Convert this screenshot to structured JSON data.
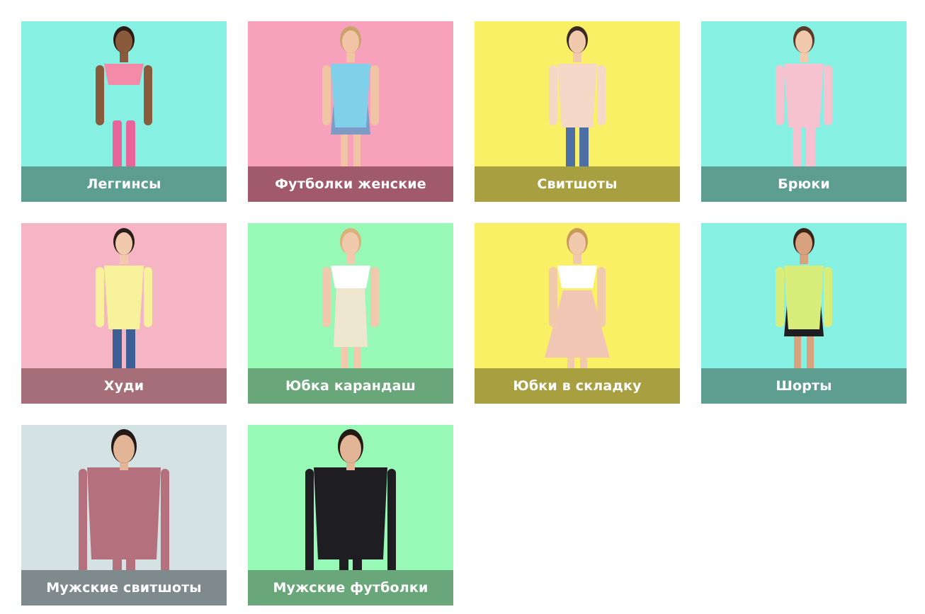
{
  "categories": [
    {
      "label": "Леггинсы",
      "bg": "#86F0E2",
      "band": "#5E9E90",
      "figure": "woman-leggings",
      "skin": "#8a5a3c",
      "hair": "#2b1d16",
      "top": "#f28aa8",
      "bottom": "#e8659b",
      "legs": "#e8659b"
    },
    {
      "label": "Футболки женские",
      "bg": "#F7A1BC",
      "band": "#A05A6B",
      "figure": "woman-tshirt",
      "skin": "#f1c4a6",
      "hair": "#c9a36a",
      "top": "#7fd0e8",
      "bottom": "#7d9bc4",
      "legs": "#f1c4a6"
    },
    {
      "label": "Свитшоты",
      "bg": "#FAF066",
      "band": "#A8A040",
      "figure": "woman-sweatshirt",
      "skin": "#f1c9ad",
      "hair": "#3a2a22",
      "top": "#f6d8c8",
      "bottom": "#4d6fa3",
      "legs": "#4d6fa3"
    },
    {
      "label": "Брюки",
      "bg": "#86F0E2",
      "band": "#5E9E90",
      "figure": "woman-pants",
      "skin": "#f1c9ad",
      "hair": "#5a3b2a",
      "top": "#f7c2d0",
      "bottom": "#f7c2d0",
      "legs": "#f7c2d0"
    },
    {
      "label": "Худи",
      "bg": "#F5B5C5",
      "band": "#A56E78",
      "figure": "woman-hoodie",
      "skin": "#f1c9ad",
      "hair": "#2a1f1a",
      "top": "#f6f19a",
      "bottom": "#3d5f95",
      "legs": "#3d5f95"
    },
    {
      "label": "Юбка карандаш",
      "bg": "#98F8B6",
      "band": "#69A77A",
      "figure": "woman-pencil-skirt",
      "skin": "#f1c9ad",
      "hair": "#d9b27a",
      "top": "#ffffff",
      "bottom": "#efe6cf",
      "legs": "#f1c9ad"
    },
    {
      "label": "Юбки в складку",
      "bg": "#FAF066",
      "band": "#A8A040",
      "figure": "woman-pleated-skirt",
      "skin": "#f1c9ad",
      "hair": "#c89a5a",
      "top": "#ffffff",
      "bottom": "#f2c6b4",
      "legs": "#f1c9ad"
    },
    {
      "label": "Шорты",
      "bg": "#86F0E2",
      "band": "#5E9E90",
      "figure": "woman-shorts",
      "skin": "#d8a27e",
      "hair": "#3a2418",
      "top": "#d9ee7a",
      "bottom": "#1e1e22",
      "legs": "#d8a27e"
    },
    {
      "label": "Мужские свитшоты",
      "bg": "#D4E2E3",
      "band": "#7E8A8B",
      "figure": "man-sweatshirt",
      "skin": "#e2b596",
      "hair": "#231915",
      "top": "#b4707c",
      "bottom": "#b4707c",
      "legs": "#b4707c"
    },
    {
      "label": "Мужские футболки",
      "bg": "#98F8B6",
      "band": "#69A77A",
      "figure": "man-tshirt",
      "skin": "#e2b596",
      "hair": "#231915",
      "top": "#1d1d22",
      "bottom": "#1d1d22",
      "legs": "#1d1d22"
    }
  ]
}
